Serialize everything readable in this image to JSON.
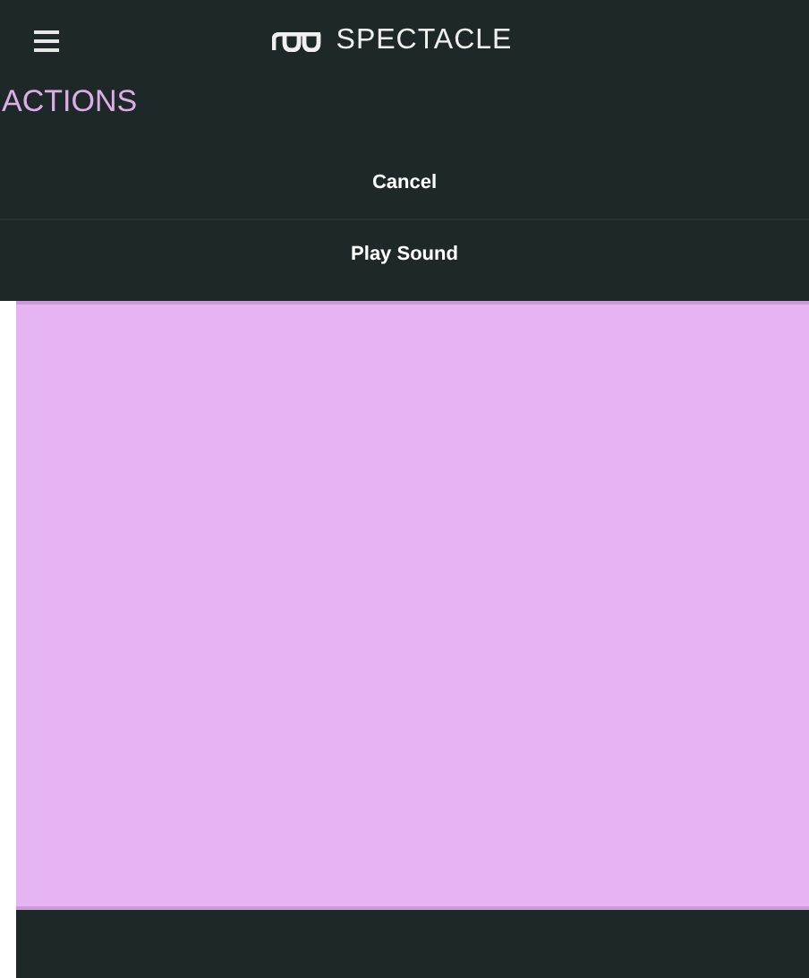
{
  "header": {
    "title": "SPECTACLE"
  },
  "section": {
    "title": "ACTIONS"
  },
  "actions": [
    {
      "label": "Cancel"
    },
    {
      "label": "Play Sound"
    }
  ]
}
